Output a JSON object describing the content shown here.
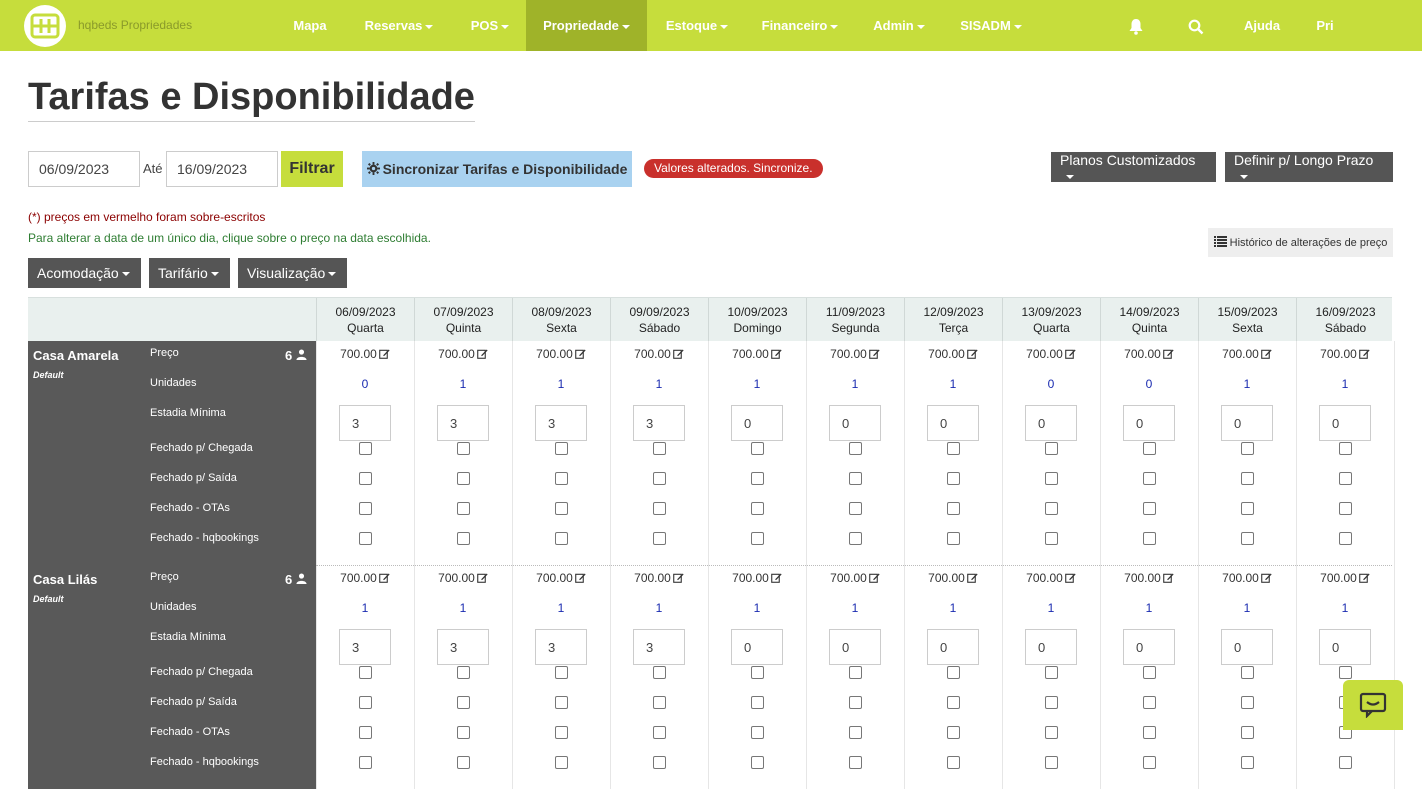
{
  "navbar": {
    "brand": "hqbeds Propriedades",
    "items": [
      {
        "label": "Mapa",
        "caret": false,
        "active": false
      },
      {
        "label": "Reservas",
        "caret": true,
        "active": false
      },
      {
        "label": "POS",
        "caret": true,
        "active": false
      },
      {
        "label": "Propriedade",
        "caret": true,
        "active": true
      },
      {
        "label": "Estoque",
        "caret": true,
        "active": false
      },
      {
        "label": "Financeiro",
        "caret": true,
        "active": false
      },
      {
        "label": "Admin",
        "caret": true,
        "active": false
      },
      {
        "label": "SISADM",
        "caret": true,
        "active": false
      }
    ],
    "bell_icon": "bell-icon",
    "search_icon": "search-icon",
    "help": "Ajuda",
    "user": "Pri"
  },
  "page": {
    "title": "Tarifas e Disponibilidade"
  },
  "filter": {
    "from_date": "06/09/2023",
    "ate_label": "Até",
    "to_date": "16/09/2023",
    "filter_button": "Filtrar",
    "sync_button": "Sincronizar Tarifas e Disponibilidade",
    "alert_badge": "Valores alterados. Sincronize.",
    "custom_plans_button": "Planos Customizados",
    "long_term_button": "Definir p/ Longo Prazo"
  },
  "notes": {
    "red": "(*) preços em vermelho foram sobre-escritos",
    "green": "Para alterar a data de um único dia, clique sobre o preço na data escolhida."
  },
  "history_button": "Histórico de alterações de preço",
  "view_buttons": {
    "acomodacao": "Acomodação",
    "tarifario": "Tarifário",
    "visualizacao": "Visualização"
  },
  "dates": [
    {
      "date": "06/09/2023",
      "day": "Quarta"
    },
    {
      "date": "07/09/2023",
      "day": "Quinta"
    },
    {
      "date": "08/09/2023",
      "day": "Sexta"
    },
    {
      "date": "09/09/2023",
      "day": "Sábado"
    },
    {
      "date": "10/09/2023",
      "day": "Domingo"
    },
    {
      "date": "11/09/2023",
      "day": "Segunda"
    },
    {
      "date": "12/09/2023",
      "day": "Terça"
    },
    {
      "date": "13/09/2023",
      "day": "Quarta"
    },
    {
      "date": "14/09/2023",
      "day": "Quinta"
    },
    {
      "date": "15/09/2023",
      "day": "Sexta"
    },
    {
      "date": "16/09/2023",
      "day": "Sábado"
    }
  ],
  "row_labels": {
    "preco": "Preço",
    "unidades": "Unidades",
    "estadia": "Estadia Mínima",
    "fechado_chegada": "Fechado p/ Chegada",
    "fechado_saida": "Fechado p/ Saída",
    "fechado_otas": "Fechado - OTAs",
    "fechado_hq": "Fechado - hqbookings"
  },
  "rooms": [
    {
      "name": "Casa Amarela",
      "plan": "Default",
      "capacity": "6",
      "prices": [
        "700.00",
        "700.00",
        "700.00",
        "700.00",
        "700.00",
        "700.00",
        "700.00",
        "700.00",
        "700.00",
        "700.00",
        "700.00"
      ],
      "units": [
        "0",
        "1",
        "1",
        "1",
        "1",
        "1",
        "1",
        "0",
        "0",
        "1",
        "1"
      ],
      "min_stay": [
        "3",
        "3",
        "3",
        "3",
        "0",
        "0",
        "0",
        "0",
        "0",
        "0",
        "0"
      ]
    },
    {
      "name": "Casa Lilás",
      "plan": "Default",
      "capacity": "6",
      "prices": [
        "700.00",
        "700.00",
        "700.00",
        "700.00",
        "700.00",
        "700.00",
        "700.00",
        "700.00",
        "700.00",
        "700.00",
        "700.00"
      ],
      "units": [
        "1",
        "1",
        "1",
        "1",
        "1",
        "1",
        "1",
        "1",
        "1",
        "1",
        "1"
      ],
      "min_stay": [
        "3",
        "3",
        "3",
        "3",
        "0",
        "0",
        "0",
        "0",
        "0",
        "0",
        "0"
      ]
    }
  ],
  "chat_icon": "chat-icon"
}
